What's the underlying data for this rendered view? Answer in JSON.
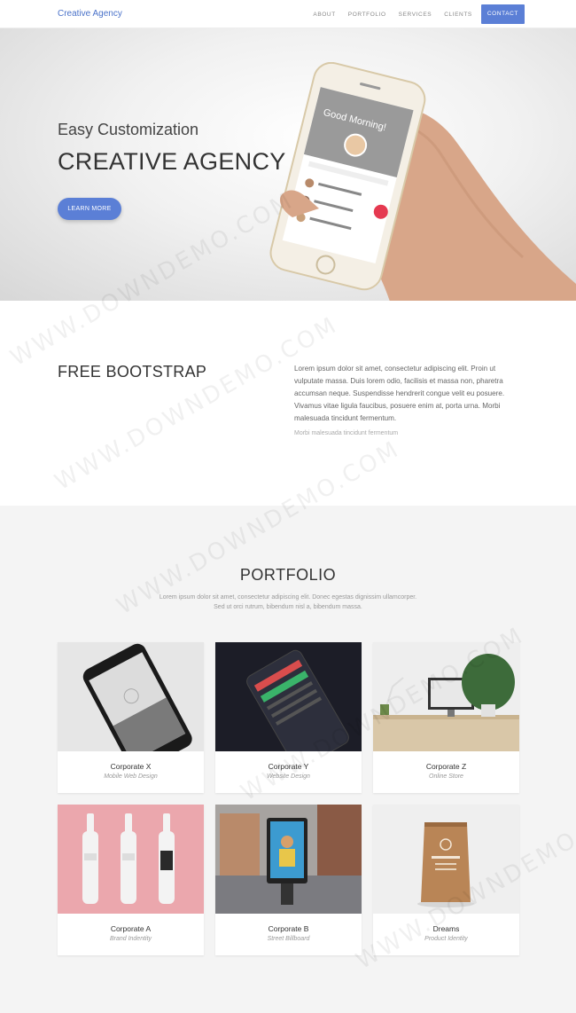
{
  "nav": {
    "brand": "Creative Agency",
    "links": [
      "ABOUT",
      "PORTFOLIO",
      "SERVICES",
      "CLIENTS"
    ],
    "contact": "CONTACT"
  },
  "hero": {
    "subtitle": "Easy Customization",
    "title": "CREATIVE AGENCY",
    "button": "LEARN MORE",
    "phone_greeting": "Good Morning!"
  },
  "about": {
    "title": "FREE BOOTSTRAP",
    "text": "Lorem ipsum dolor sit amet, consectetur adipiscing elit. Proin ut vulputate massa. Duis lorem odio, facilisis et massa non, pharetra accumsan neque. Suspendisse hendrerit congue velit eu posuere. Vivamus vitae ligula faucibus, posuere enim at, porta urna. Morbi malesuada tincidunt fermentum.",
    "note": "Morbi malesuada tincidunt fermentum"
  },
  "portfolio": {
    "title": "PORTFOLIO",
    "desc_line1": "Lorem ipsum dolor sit amet, consectetur adipiscing elit. Donec egestas dignissim ullamcorper.",
    "desc_line2": "Sed ut orci rutrum, bibendum nisl a, bibendum massa.",
    "items": [
      {
        "title": "Corporate X",
        "subtitle": "Mobile Web Design"
      },
      {
        "title": "Corporate Y",
        "subtitle": "Website Design"
      },
      {
        "title": "Corporate Z",
        "subtitle": "Online Store"
      },
      {
        "title": "Corporate A",
        "subtitle": "Brand Indentity"
      },
      {
        "title": "Corporate B",
        "subtitle": "Street Billboard"
      },
      {
        "title": "Dreams",
        "subtitle": "Product Identity"
      }
    ]
  },
  "watermark": "WWW.DOWNDEMO.COM",
  "colors": {
    "accent": "#5b7fd6",
    "brand_text": "#4a72c9",
    "portfolio_bg": "#f4f4f4"
  }
}
